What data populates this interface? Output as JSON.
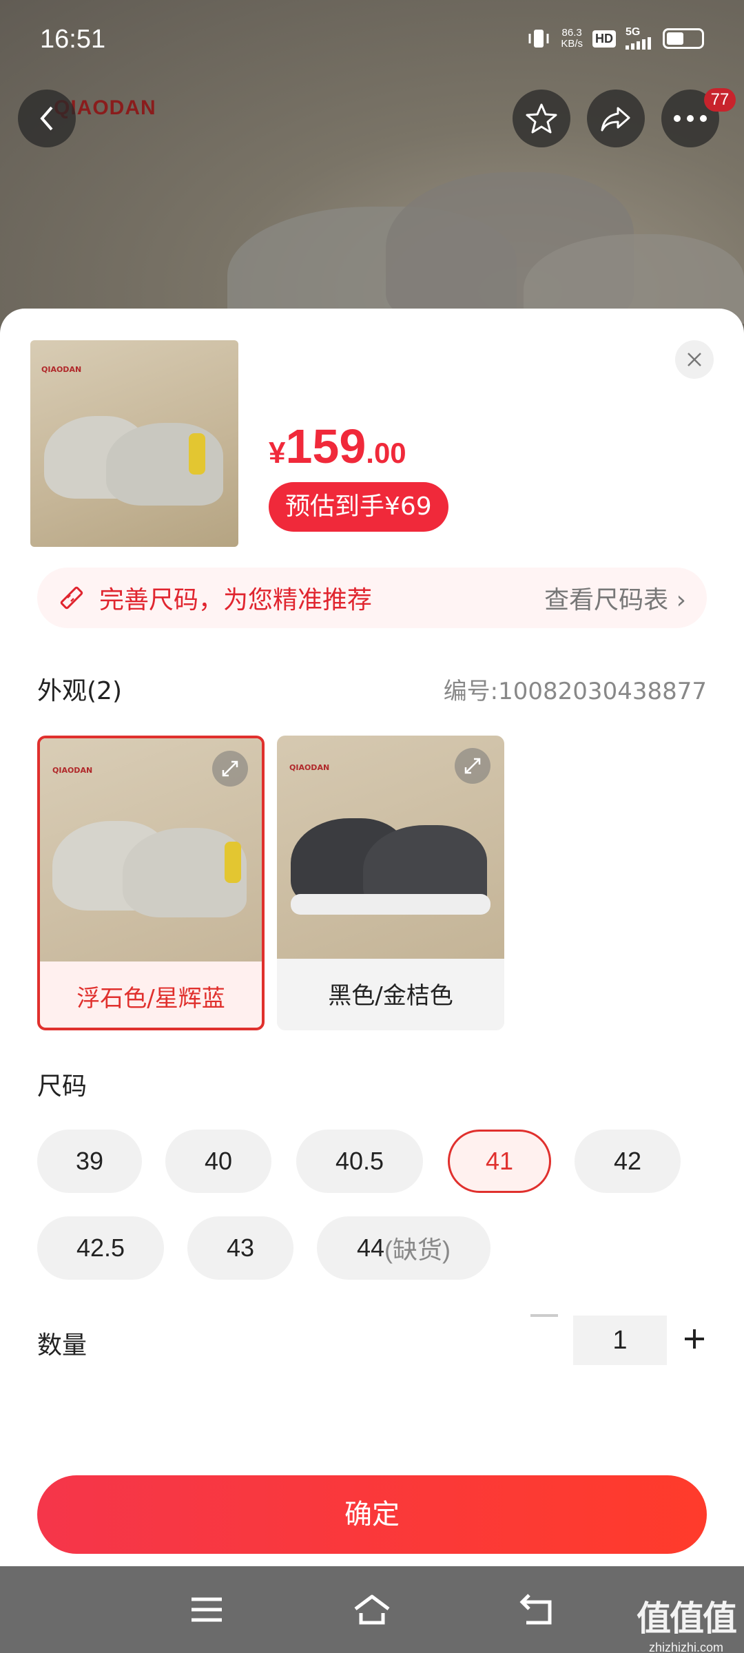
{
  "status_bar": {
    "time": "16:51",
    "net_speed_value": "86.3",
    "net_speed_unit": "KB/s",
    "hd": "HD",
    "network": "5G"
  },
  "nav": {
    "more_badge": "77"
  },
  "hero": {
    "brand_logo": "QIAODAN"
  },
  "product": {
    "price_currency": "¥",
    "price_int": "159",
    "price_dec": ".00",
    "estimate": "预估到手¥69",
    "thumb_logo": "QIAODAN"
  },
  "size_tip": {
    "text": "完善尺码，为您精准推荐",
    "link": "查看尺码表 ›"
  },
  "appearance": {
    "title": "外观(2)",
    "sku": "编号:10082030438877",
    "options": [
      {
        "label": "浮石色/星辉蓝",
        "selected": true,
        "logo": "QIAODAN"
      },
      {
        "label": "黑色/金桔色",
        "selected": false,
        "logo": "QIAODAN"
      }
    ]
  },
  "size": {
    "title": "尺码",
    "options": [
      {
        "label": "39"
      },
      {
        "label": "40"
      },
      {
        "label": "40.5"
      },
      {
        "label": "41",
        "selected": true
      },
      {
        "label": "42"
      },
      {
        "label": "42.5"
      },
      {
        "label": "43"
      },
      {
        "label": "44",
        "note": "(缺货)"
      }
    ]
  },
  "quantity": {
    "title": "数量",
    "value": "1"
  },
  "confirm_label": "确定",
  "watermark": {
    "main": "值值值",
    "sub": "zhizhizhi.com"
  },
  "colors": {
    "accent": "#f0293a",
    "selected_border": "#e0302d"
  }
}
